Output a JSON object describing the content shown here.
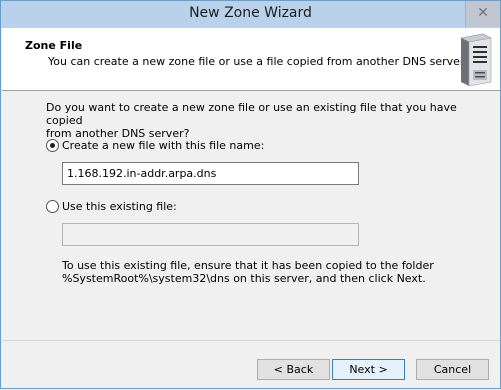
{
  "window": {
    "title": "New Zone Wizard",
    "close_glyph": "✕"
  },
  "header": {
    "title": "Zone File",
    "subtitle": "You can create a new zone file or use a file copied from another DNS server.",
    "icon": "server-icon"
  },
  "content": {
    "question_line1": "Do you want to create a new zone file or use an existing file that you have copied",
    "question_line2": "from another DNS server?",
    "option_new": {
      "label": "Create a new file with this file name:",
      "checked": true
    },
    "new_file_name": "1.168.192.in-addr.arpa.dns",
    "option_existing": {
      "label": "Use this existing file:",
      "checked": false
    },
    "existing_file_name": "",
    "note_line1": "To use this existing file, ensure that it has been copied to the folder",
    "note_line2": "%SystemRoot%\\system32\\dns on this server, and then click Next."
  },
  "footer": {
    "back": "< Back",
    "next": "Next >",
    "cancel": "Cancel"
  }
}
